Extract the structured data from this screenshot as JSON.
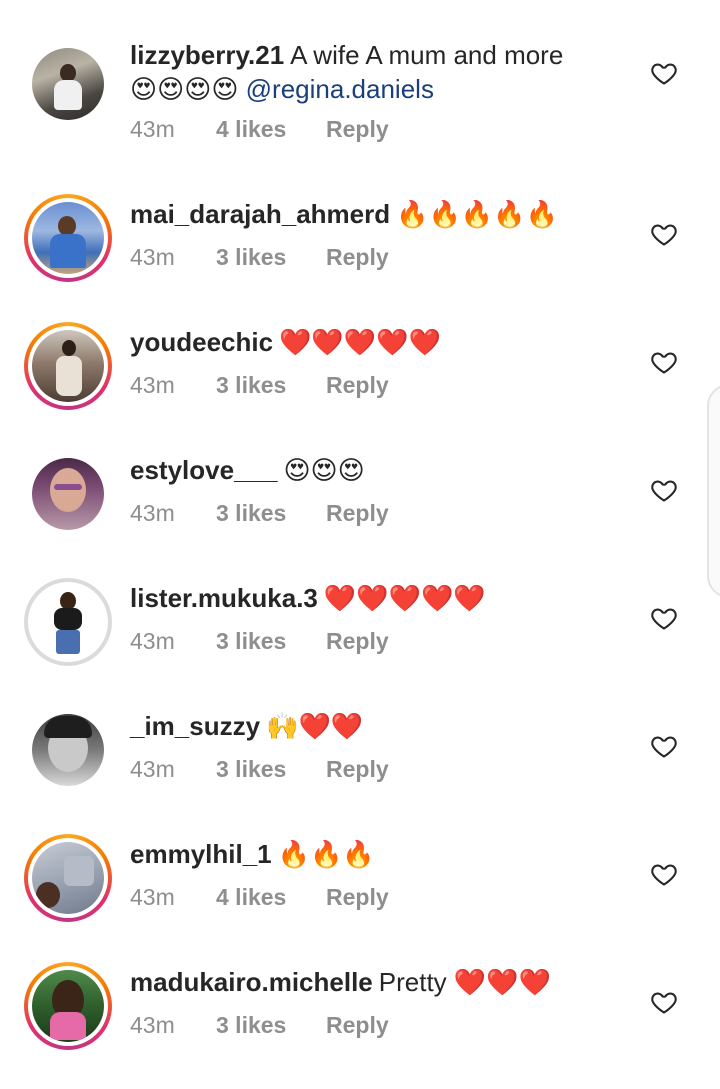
{
  "comments": [
    {
      "username": "lizzyberry.21",
      "text": "A wife A mum and more",
      "emoji_line": "😍😍😍😍",
      "mention": "@regina.daniels",
      "time": "43m",
      "likes": "4 likes",
      "reply": "Reply"
    },
    {
      "username": "mai_darajah_ahmerd",
      "text": "🔥🔥🔥🔥🔥",
      "time": "43m",
      "likes": "3 likes",
      "reply": "Reply"
    },
    {
      "username": "youdeechic",
      "text": "❤️❤️❤️❤️❤️",
      "time": "43m",
      "likes": "3 likes",
      "reply": "Reply"
    },
    {
      "username": "estylove___",
      "text": "😍😍😍",
      "time": "43m",
      "likes": "3 likes",
      "reply": "Reply"
    },
    {
      "username": "lister.mukuka.3",
      "text": "❤️❤️❤️❤️❤️",
      "time": "43m",
      "likes": "3 likes",
      "reply": "Reply"
    },
    {
      "username": "_im_suzzy",
      "text": "🙌❤️❤️",
      "time": "43m",
      "likes": "3 likes",
      "reply": "Reply"
    },
    {
      "username": "emmylhil_1",
      "text": "🔥🔥🔥",
      "time": "43m",
      "likes": "4 likes",
      "reply": "Reply"
    },
    {
      "username": "madukairo.michelle",
      "text": "Pretty ❤️❤️❤️",
      "time": "43m",
      "likes": "3 likes",
      "reply": "Reply"
    }
  ],
  "icons": {
    "like": "heart-outline-icon"
  },
  "colors": {
    "story_ring": "#e1306c",
    "mention": "#1a3f7a",
    "meta": "#8e8e8e"
  }
}
